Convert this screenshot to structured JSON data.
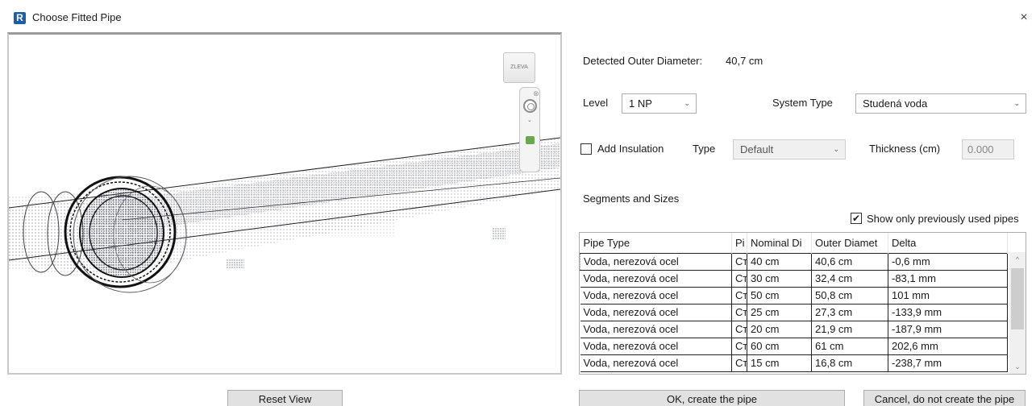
{
  "window": {
    "title": "Choose Fitted Pipe",
    "app_icon_letter": "R",
    "close_glyph": "×"
  },
  "viewport": {
    "viewcube_label": "ZLEVA",
    "reset_view_label": "Reset View"
  },
  "detected": {
    "label": "Detected Outer Diameter:",
    "value": "40,7 cm"
  },
  "level": {
    "label": "Level",
    "value": "1 NP"
  },
  "system_type": {
    "label": "System Type",
    "value": "Studená voda"
  },
  "insulation": {
    "checkbox_label": "Add Insulation",
    "checked": false,
    "type_label": "Type",
    "type_value": "Default",
    "thickness_label": "Thickness (cm)",
    "thickness_value": "0.000"
  },
  "segments": {
    "label": "Segments and Sizes",
    "show_used_label": "Show only previously used pipes",
    "show_used_checked": true,
    "columns": [
      "Pipe Type",
      "Pi",
      "Nominal Di",
      "Outer Diamet",
      "Delta"
    ],
    "rows": [
      [
        "Voda, nerezová ocel",
        "Ст",
        "40 cm",
        "40,6 cm",
        "-0,6 mm"
      ],
      [
        "Voda, nerezová ocel",
        "Ст",
        "30 cm",
        "32,4 cm",
        "-83,1 mm"
      ],
      [
        "Voda, nerezová ocel",
        "Ст",
        "50 cm",
        "50,8 cm",
        "101 mm"
      ],
      [
        "Voda, nerezová ocel",
        "Ст",
        "25 cm",
        "27,3 cm",
        "-133,9 mm"
      ],
      [
        "Voda, nerezová ocel",
        "Ст",
        "20 cm",
        "21,9 cm",
        "-187,9 mm"
      ],
      [
        "Voda, nerezová ocel",
        "Ст",
        "60 cm",
        "61 cm",
        "202,6 mm"
      ],
      [
        "Voda, nerezová ocel",
        "Ст",
        "15 cm",
        "16,8 cm",
        "-238,7 mm"
      ]
    ]
  },
  "buttons": {
    "ok": "OK, create the pipe",
    "cancel": "Cancel, do not create the pipe"
  },
  "icons": {
    "chevron": "⌄",
    "check": "✔",
    "scroll_up": "^",
    "scroll_down": "⌄"
  },
  "colors": {
    "point_cloud": "#2a2a4a",
    "accent_icon": "#1b5fa8"
  }
}
